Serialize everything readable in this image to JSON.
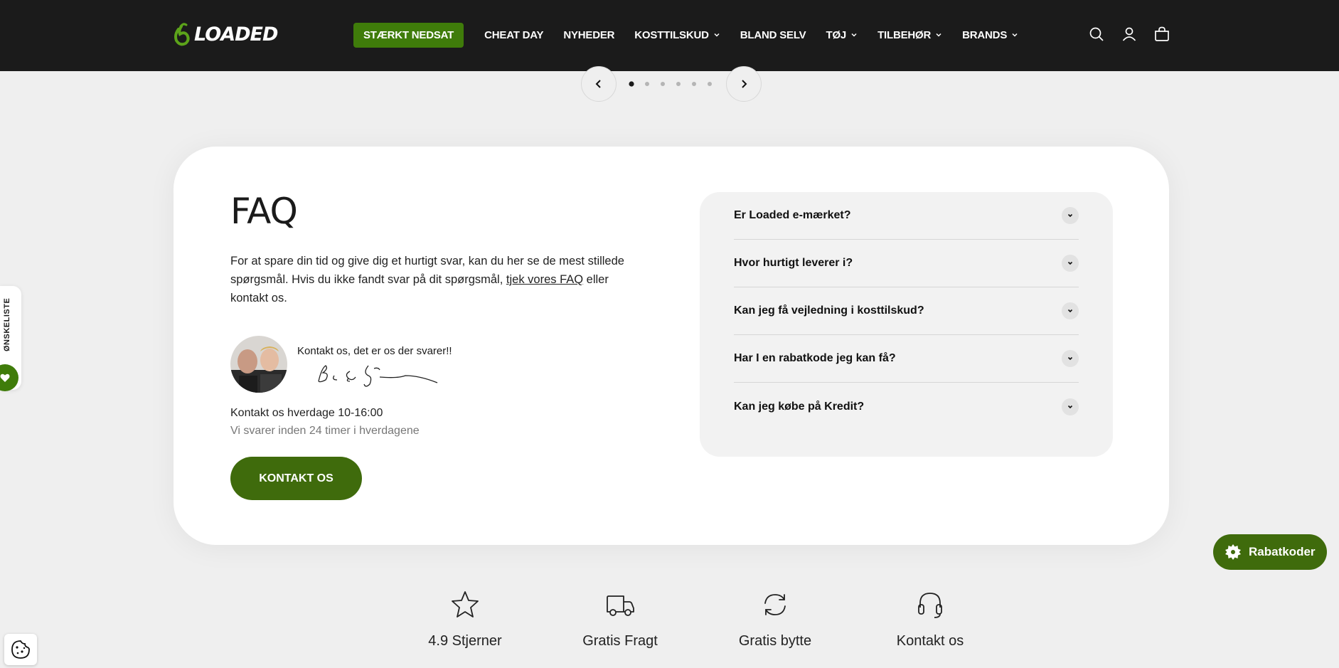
{
  "header": {
    "logo_text": "LOADED",
    "nav": [
      {
        "label": "STÆRKT NEDSAT",
        "dropdown": false,
        "highlight": true
      },
      {
        "label": "CHEAT DAY",
        "dropdown": false
      },
      {
        "label": "NYHEDER",
        "dropdown": false
      },
      {
        "label": "KOSTTILSKUD",
        "dropdown": true
      },
      {
        "label": "BLAND SELV",
        "dropdown": false
      },
      {
        "label": "TØJ",
        "dropdown": true
      },
      {
        "label": "TILBEHØR",
        "dropdown": true
      },
      {
        "label": "BRANDS",
        "dropdown": true
      }
    ],
    "icons": [
      "search-icon",
      "account-icon",
      "cart-icon"
    ]
  },
  "carousel": {
    "dot_count": 6,
    "active_index": 0
  },
  "faq": {
    "title": "FAQ",
    "intro_before_link": "For at spare din tid og give dig et hurtigt svar, kan du her se de mest stillede spørgsmål. Hvis du ikke fandt svar på dit spørgsmål, ",
    "intro_link": "tjek vores FAQ",
    "intro_after_link": " eller kontakt os.",
    "contact_line": "Kontakt os, det er os der svarer!!",
    "hours": "Kontakt os hverdage 10-16:00",
    "reply_time": "Vi svarer inden 24 timer i hverdagene",
    "button": "KONTAKT OS",
    "questions": [
      "Er Loaded e-mærket?",
      "Hvor hurtigt leverer i?",
      "Kan jeg få vejledning i kosttilskud?",
      "Har I en rabatkode jeg kan få?",
      "Kan jeg købe på Kredit?"
    ]
  },
  "features": [
    {
      "icon": "star-icon",
      "label": "4.9 Stjerner"
    },
    {
      "icon": "truck-icon",
      "label": "Gratis Fragt"
    },
    {
      "icon": "exchange-icon",
      "label": "Gratis bytte"
    },
    {
      "icon": "headset-icon",
      "label": "Kontakt os"
    }
  ],
  "wishlist": {
    "label": "ØNSKELISTE"
  },
  "rabat": {
    "label": "Rabatkoder"
  },
  "colors": {
    "brand_green": "#3f7c0a",
    "header_bg": "#1b1b1b",
    "page_bg": "#efefef"
  }
}
